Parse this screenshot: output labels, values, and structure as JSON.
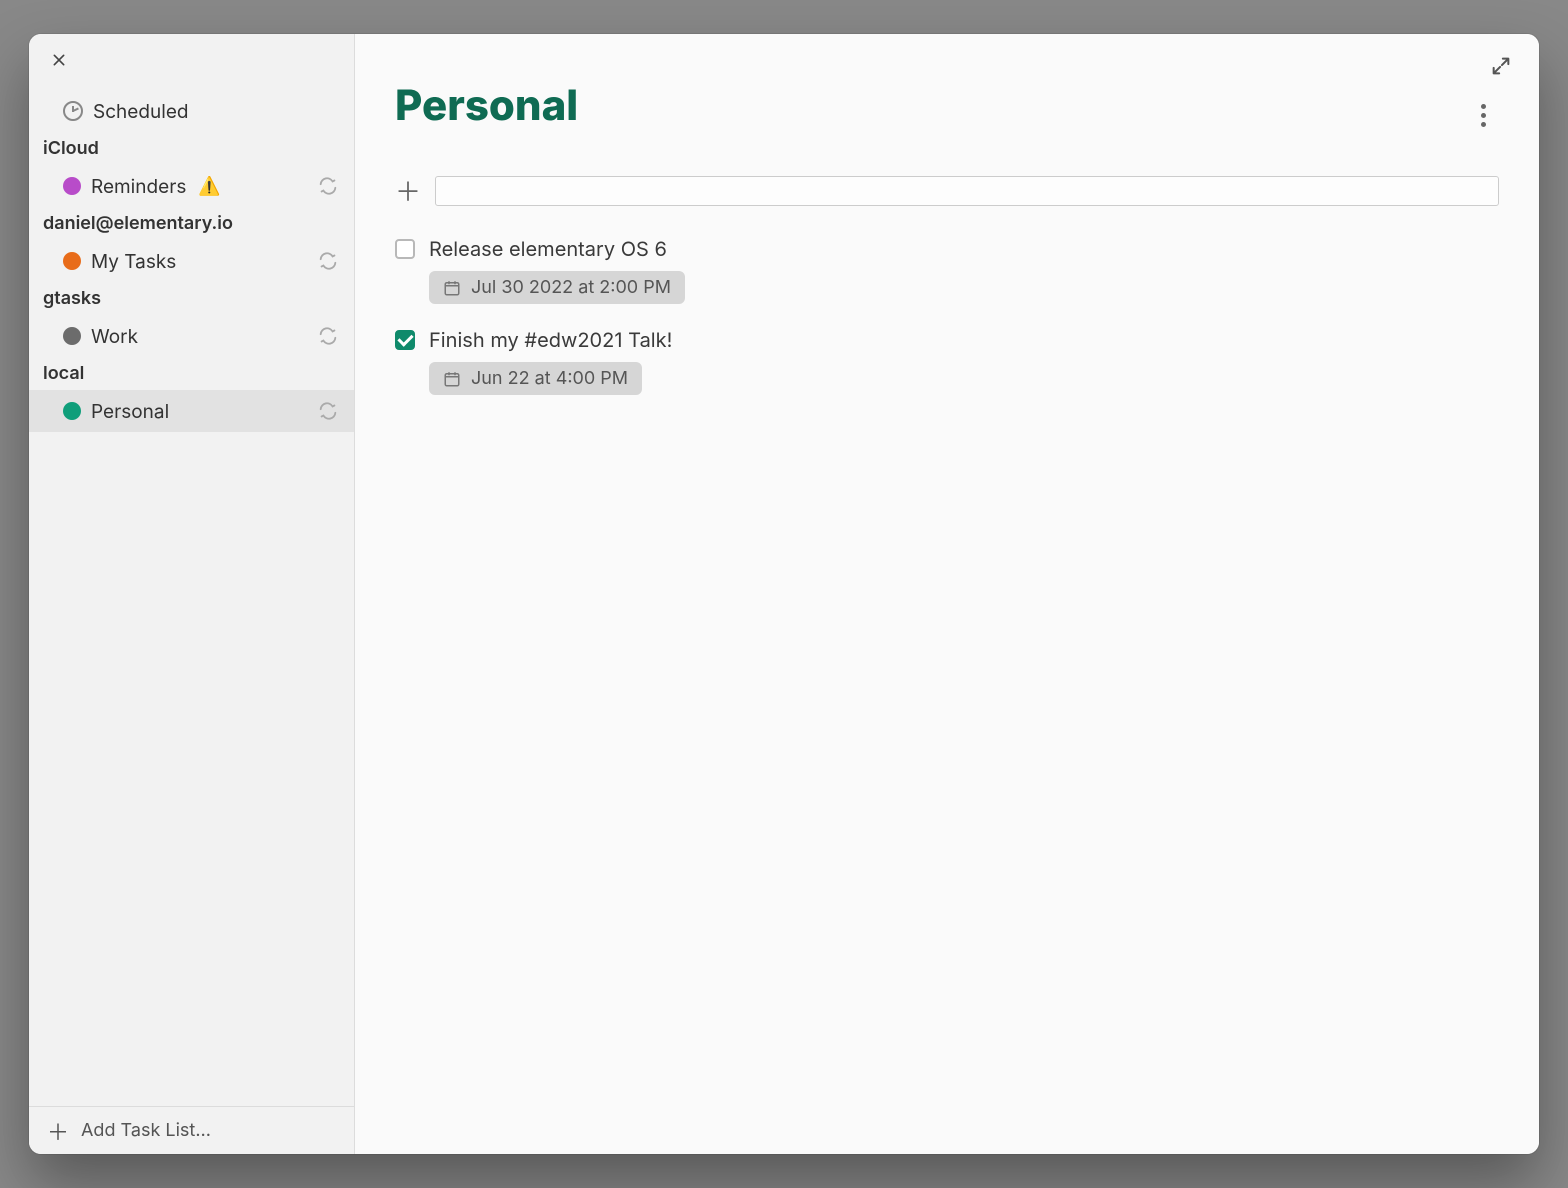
{
  "sidebar": {
    "scheduled_label": "Scheduled",
    "sections": [
      {
        "name": "iCloud",
        "lists": [
          {
            "label": "Reminders",
            "color": "#b84cc9",
            "warning": true
          }
        ]
      },
      {
        "name": "daniel@elementary.io",
        "lists": [
          {
            "label": "My Tasks",
            "color": "#e86c1a",
            "warning": false
          }
        ]
      },
      {
        "name": "gtasks",
        "lists": [
          {
            "label": "Work",
            "color": "#6c6c6c",
            "warning": false
          }
        ]
      },
      {
        "name": "local",
        "lists": [
          {
            "label": "Personal",
            "color": "#0f9e7a",
            "warning": false,
            "selected": true
          }
        ]
      }
    ],
    "add_list_label": "Add Task List…"
  },
  "main": {
    "title": "Personal",
    "accent_color": "#0f6b53",
    "new_task_placeholder": "",
    "tasks": [
      {
        "title": "Release elementary OS 6",
        "done": false,
        "date_label": "Jul 30 2022 at 2:00 PM"
      },
      {
        "title": "Finish my #edw2021 Talk!",
        "done": true,
        "date_label": "Jun 22 at 4:00 PM"
      }
    ]
  }
}
